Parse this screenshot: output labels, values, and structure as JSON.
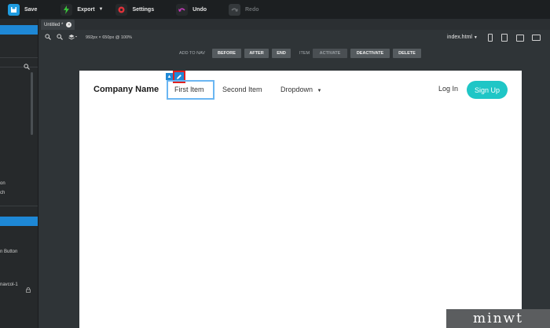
{
  "toolbar": {
    "save": "Save",
    "export": "Export",
    "settings": "Settings",
    "undo": "Undo",
    "redo": "Redo",
    "colors": {
      "save": "#1e9be0",
      "export": "#39c23a",
      "settings": "#e0323a",
      "undo": "#c03ab6"
    }
  },
  "left_panel": {
    "fragments": [
      {
        "name": "lp-text-on",
        "text": "on"
      },
      {
        "name": "lp-text-ch",
        "text": "ch"
      },
      {
        "name": "lp-text-button",
        "text": "n Button"
      },
      {
        "name": "lp-text-navcol",
        "text": "navcol-1"
      }
    ]
  },
  "tab": {
    "label": "Untitled *"
  },
  "bar2": {
    "zoom": "992px × 650px @ 100%",
    "file": "index.html"
  },
  "nav_actions": {
    "add_to_nav": "ADD TO NAV",
    "before": "BEFORE",
    "after": "AFTER",
    "end": "END",
    "item": "ITEM",
    "activate": "ACTIVATE",
    "deactivate": "DEACTIVATE",
    "delete": "DELETE"
  },
  "canvas": {
    "brand": "Company Name",
    "items": [
      "First Item",
      "Second Item",
      "Dropdown"
    ],
    "login": "Log In",
    "signup": "Sign Up",
    "accent": "#1fc6c6"
  },
  "watermark": "minwt"
}
